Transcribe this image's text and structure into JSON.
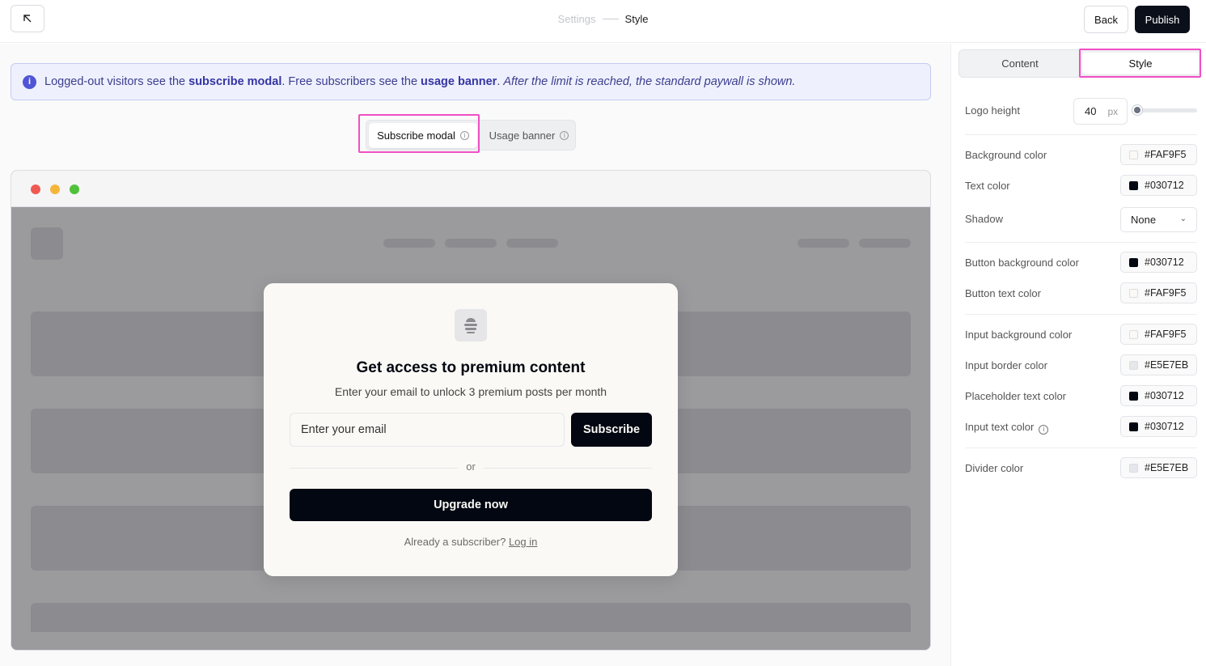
{
  "header": {
    "crumbs": [
      "Settings",
      "Style"
    ],
    "back_label": "Back",
    "publish_label": "Publish"
  },
  "info": {
    "part1": "Logged-out visitors see the ",
    "bold1": "subscribe modal",
    "part2": ". Free subscribers see the ",
    "bold2": "usage banner",
    "part3": ". ",
    "italic": "After the limit is reached, the standard paywall is shown."
  },
  "preview_tabs": {
    "active": "Subscribe modal",
    "inactive": "Usage banner"
  },
  "modal": {
    "title": "Get access to premium content",
    "subtitle": "Enter your email to unlock 3 premium posts per month",
    "email_placeholder": "Enter your email",
    "subscribe_label": "Subscribe",
    "or_label": "or",
    "upgrade_label": "Upgrade now",
    "login_prefix": "Already a subscriber? ",
    "login_link": "Log in"
  },
  "panel": {
    "tabs": [
      "Content",
      "Style"
    ],
    "active_tab": "Style",
    "logo_height": {
      "label": "Logo height",
      "value": "40",
      "unit": "px",
      "slider_fraction": 0.05
    },
    "fields": [
      {
        "label": "Background color",
        "value": "#FAF9F5"
      },
      {
        "label": "Text color",
        "value": "#030712"
      },
      {
        "label": "Shadow",
        "value": "None"
      },
      {
        "label": "Button background color",
        "value": "#030712"
      },
      {
        "label": "Button text color",
        "value": "#FAF9F5"
      },
      {
        "label": "Input background color",
        "value": "#FAF9F5"
      },
      {
        "label": "Input border color",
        "value": "#E5E7EB"
      },
      {
        "label": "Placeholder text color",
        "value": "#030712"
      },
      {
        "label": "Input text color",
        "value": "#030712"
      },
      {
        "label": "Divider color",
        "value": "#E5E7EB"
      }
    ]
  },
  "colors": {
    "accent_highlight": "#F04FC4",
    "publish_bg": "#0B0F1A",
    "info_bg": "#EEF1FD",
    "info_text": "#3D3D8F",
    "window_red": "#EE5A52",
    "window_yellow": "#F4B63A",
    "window_green": "#4FC13A"
  }
}
